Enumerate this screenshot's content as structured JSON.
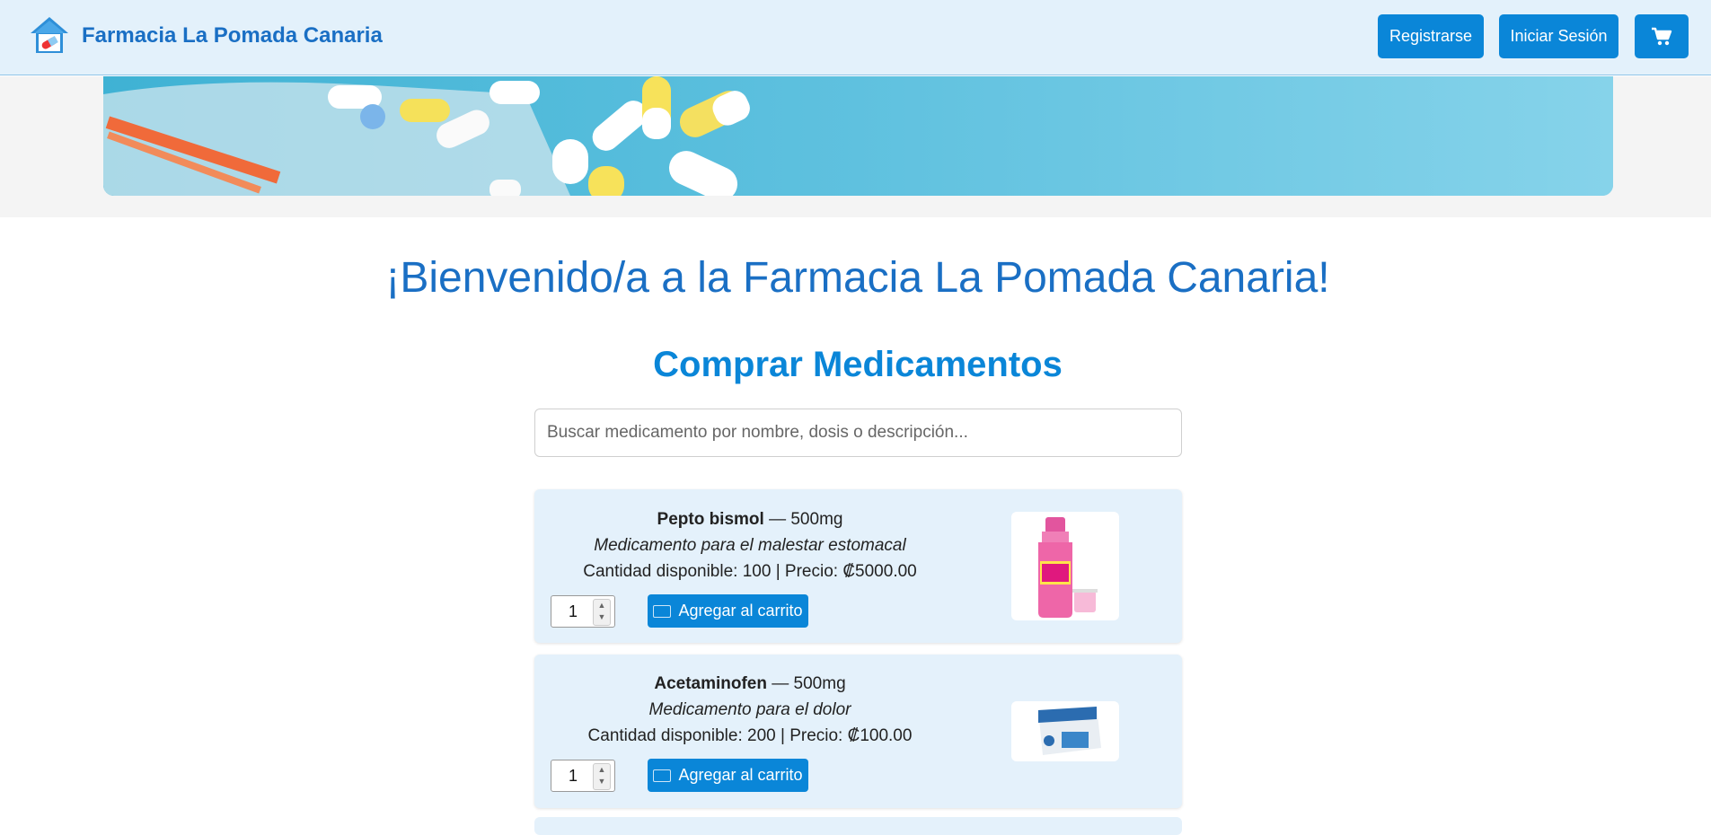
{
  "header": {
    "brand": "Farmacia La Pomada Canaria",
    "register_label": "Registrarse",
    "login_label": "Iniciar Sesión",
    "cart_icon": "shopping-cart-icon",
    "logo_icon": "house-pill-icon"
  },
  "main": {
    "welcome": "¡Bienvenido/a a la Farmacia La Pomada Canaria!",
    "shop_title": "Comprar Medicamentos",
    "search_placeholder": "Buscar medicamento por nombre, dosis o descripción..."
  },
  "products": [
    {
      "name": "Pepto bismol",
      "dose_suffix": " — 500mg",
      "description": "Medicamento para el malestar estomacal",
      "stock_line": "Cantidad disponible: 100 | Precio: ₡5000.00",
      "quantity": "1",
      "add_label": "Agregar al carrito"
    },
    {
      "name": "Acetaminofen",
      "dose_suffix": " — 500mg",
      "description": "Medicamento para el dolor",
      "stock_line": "Cantidad disponible: 200 | Precio: ₡100.00",
      "quantity": "1",
      "add_label": "Agregar al carrito"
    }
  ],
  "colors": {
    "primary": "#0a86d8",
    "brand_text": "#1a6fc4",
    "header_bg": "#e3f1fb",
    "card_bg": "#e4f1fb"
  }
}
